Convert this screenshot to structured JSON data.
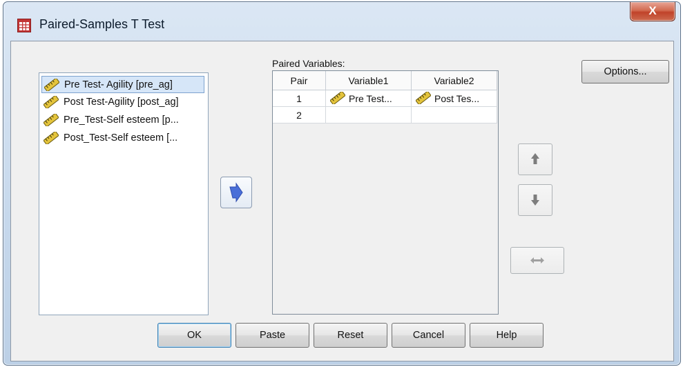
{
  "window": {
    "title": "Paired-Samples T Test",
    "close_label": "X"
  },
  "source_variables": [
    {
      "label": "Pre Test- Agility [pre_ag]",
      "selected": true
    },
    {
      "label": "Post Test-Agility [post_ag]",
      "selected": false
    },
    {
      "label": "Pre_Test-Self esteem [p...",
      "selected": false
    },
    {
      "label": "Post_Test-Self esteem [...",
      "selected": false
    }
  ],
  "paired_variables": {
    "label": "Paired Variables:",
    "columns": [
      "Pair",
      "Variable1",
      "Variable2"
    ],
    "rows": [
      {
        "pair": "1",
        "variable1": "Pre Test...",
        "variable2": "Post Tes..."
      },
      {
        "pair": "2",
        "variable1": "",
        "variable2": ""
      }
    ]
  },
  "buttons": {
    "options": "Options...",
    "ok": "OK",
    "paste": "Paste",
    "reset": "Reset",
    "cancel": "Cancel",
    "help": "Help"
  },
  "icons": {
    "app": "table-icon",
    "variable": "ruler-scale-icon",
    "move": "blue-arrow-right-icon",
    "up": "arrow-up-icon",
    "down": "arrow-down-icon",
    "swap": "swap-horizontal-icon"
  },
  "colors": {
    "accent": "#4a6fd8",
    "selection": "#d6e6f8",
    "close": "#c7452d"
  }
}
